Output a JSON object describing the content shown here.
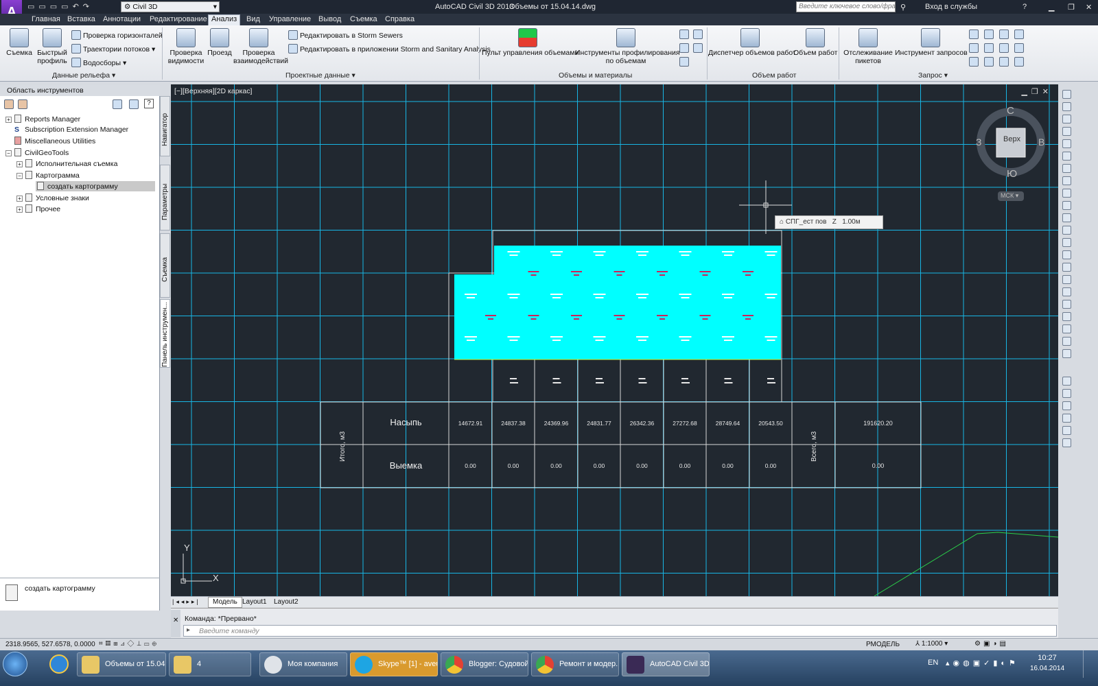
{
  "app": {
    "workspace": "Civil 3D",
    "title": "AutoCAD Civil 3D 2013",
    "drawing": "Объемы от 15.04.14.dwg",
    "search_placeholder": "Введите ключевое слово/фразу",
    "sign_in": "Вход в службы"
  },
  "menu": [
    "Главная",
    "Вставка",
    "Аннотации",
    "Редактирование",
    "Анализ",
    "Вид",
    "Управление",
    "Вывод",
    "Съемка",
    "Справка"
  ],
  "ribbon": {
    "relief": {
      "survey": "Съемка",
      "quick_profile": "Быстрый профиль",
      "check_contours": "Проверка горизонталей",
      "flow_paths": "Траектории потоков",
      "watersheds": "Водосборы",
      "panel": "Данные рельефа"
    },
    "design": {
      "visibility_1": "Проверка",
      "visibility_2": "видимости",
      "drive": "Проезд",
      "interference_1": "Проверка",
      "interference_2": "взаимодействий",
      "storm_sewers": "Редактировать в Storm Sewers",
      "ssa": "Редактировать в приложении Storm and Sanitary Analysis",
      "panel": "Проектные данные"
    },
    "volumes": {
      "dashboard": "Пульт управления объемами",
      "grading_1": "Инструменты профилирования",
      "grading_2": "по объемам",
      "panel": "Объемы и материалы"
    },
    "qto": {
      "manager": "Диспетчер объемов работ",
      "takeoff": "Объем работ",
      "panel": "Объем работ"
    },
    "inquiry": {
      "station_1": "Отслеживание",
      "station_2": "пикетов",
      "tool": "Инструмент запросов",
      "panel": "Запрос"
    }
  },
  "toolspace": {
    "title": "Область инструментов",
    "tree": [
      {
        "label": "Reports Manager"
      },
      {
        "label": "Subscription Extension Manager"
      },
      {
        "label": "Miscellaneous Utilities"
      },
      {
        "label": "CivilGeoTools"
      },
      {
        "label": "Исполнительная съемка"
      },
      {
        "label": "Картограмма"
      },
      {
        "label": "создать картограмму"
      },
      {
        "label": "Условные знаки"
      },
      {
        "label": "Прочее"
      }
    ],
    "tabs": [
      "Навигатор",
      "Параметры",
      "Съемка",
      "Панель инструмен..."
    ],
    "bottom_item": "создать картограмму"
  },
  "viewport": {
    "label": "[−][Верхняя][2D каркас]",
    "viewcube": {
      "top": "Верх",
      "n": "С",
      "s": "Ю",
      "w": "З",
      "e": "В",
      "wcs": "МСК"
    },
    "tooltip": {
      "surface": "СПГ_ест пов",
      "z_label": "Z",
      "z_value": "1.00м"
    },
    "ucs": {
      "x": "X",
      "y": "Y"
    },
    "layout_tabs": [
      "Модель",
      "Layout1",
      "Layout2"
    ]
  },
  "table": {
    "left_header": "Итого, м3",
    "right_header": "Всего, м3",
    "fill_label": "Насыпь",
    "cut_label": "Выемка",
    "fill": [
      "14672.91",
      "24837.38",
      "24369.96",
      "24831.77",
      "26342.36",
      "27272.68",
      "28749.64",
      "20543.50"
    ],
    "cut": [
      "0.00",
      "0.00",
      "0.00",
      "0.00",
      "0.00",
      "0.00",
      "0.00",
      "0.00"
    ],
    "fill_total": "191620.20",
    "cut_total": "0.00"
  },
  "command": {
    "history_label": "Команда:",
    "history_value": "*Прервано*",
    "placeholder": "Введите команду"
  },
  "status": {
    "coords": "2318.9565, 527.6578, 0.0000",
    "model": "РМОДЕЛЬ",
    "scale": "1:1000"
  },
  "taskbar": {
    "items": [
      "Объемы от 15.04...",
      "4",
      "Моя компания",
      "Skype™ [1] - aveu...",
      "Blogger: Судовой...",
      "Ремонт и модер...",
      "AutoCAD Civil 3D..."
    ],
    "lang": "EN",
    "time": "10:27",
    "date": "16.04.2014"
  },
  "colors": {
    "grid": "#18b7e6",
    "hatch": "#00ffff",
    "canvas": "#212830",
    "accent": "#e63c2f"
  }
}
